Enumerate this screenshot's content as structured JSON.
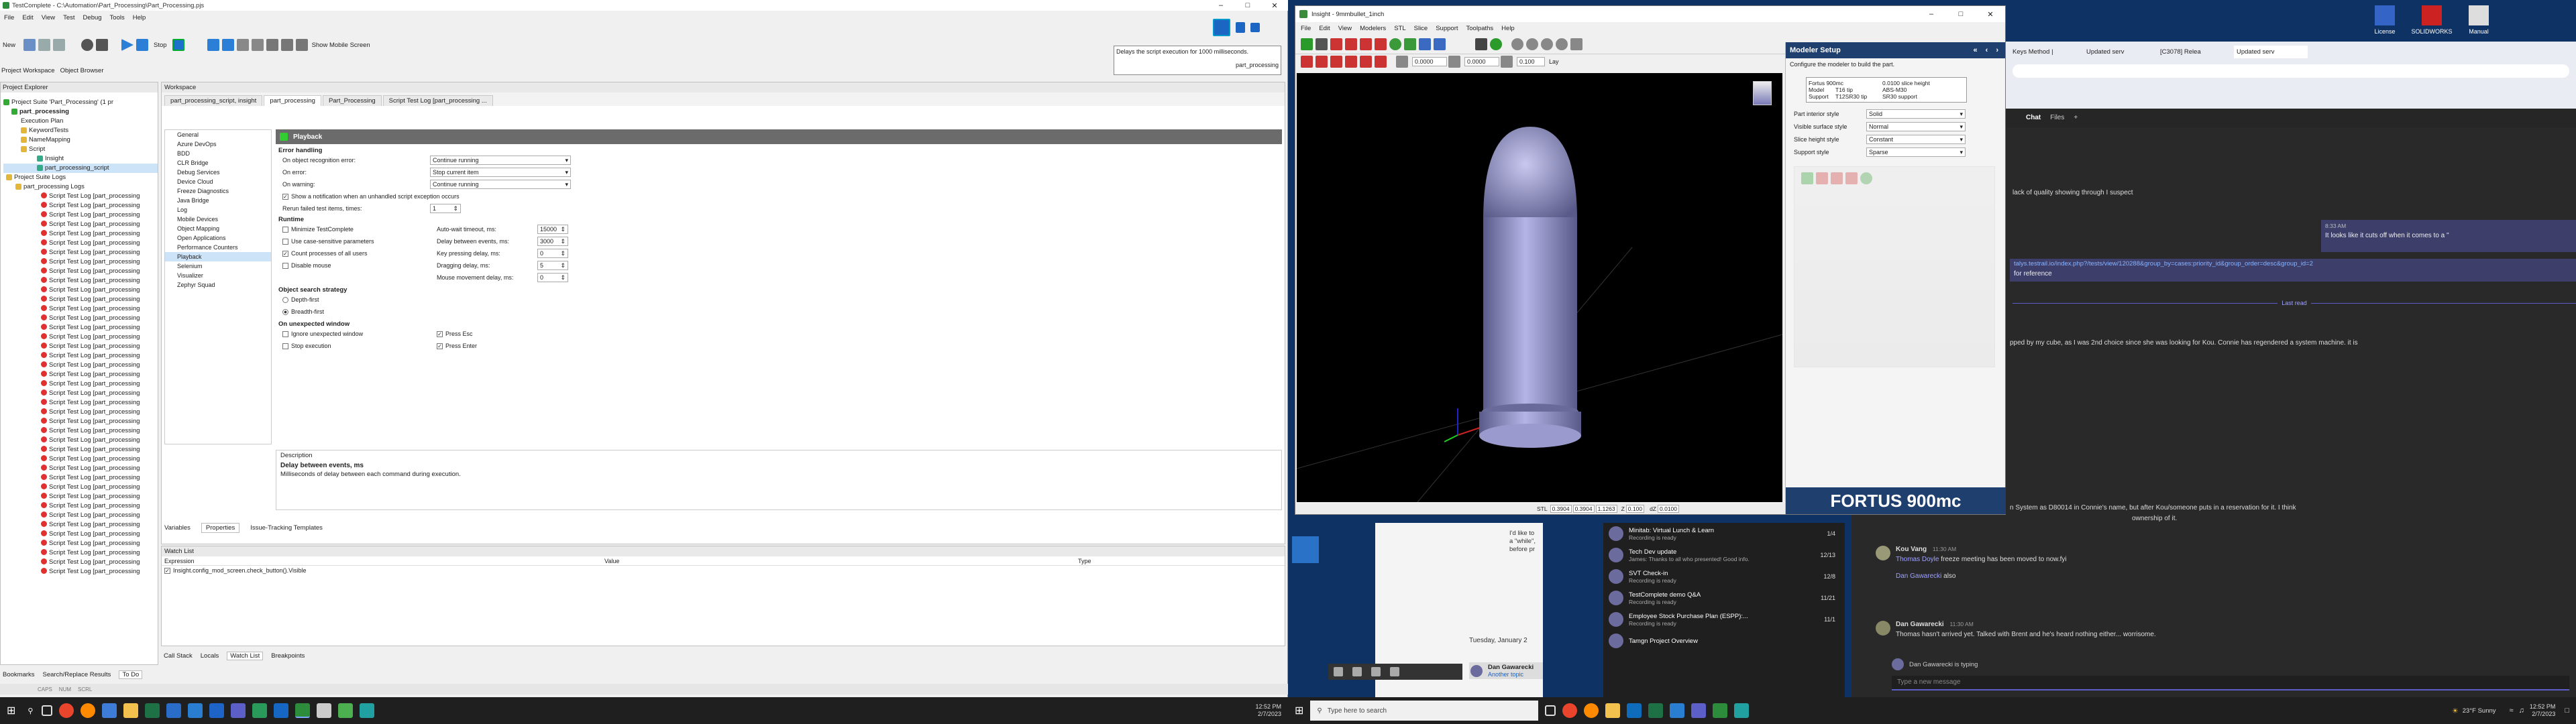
{
  "tc": {
    "title": "TestComplete - C:\\Automation\\Part_Processing\\Part_Processing.pjs",
    "menu": [
      "File",
      "Edit",
      "View",
      "Test",
      "Debug",
      "Tools",
      "Help"
    ],
    "toolbar": {
      "new": "New",
      "stop": "Stop",
      "mobile": "Show Mobile Screen"
    },
    "notice": {
      "text": "Delays the script execution for 1000 milliseconds.",
      "sub": "part_processing"
    },
    "panel_tabs": [
      "Project Workspace",
      "Object Browser"
    ],
    "explorer_title": "Project Explorer",
    "explorer_tree": [
      "Project Suite 'Part_Processing' (1 pr",
      "part_processing",
      "Execution Plan",
      "KeywordTests",
      "NameMapping",
      "Script",
      "Insight",
      "part_processing_script",
      "Project Suite Logs",
      "part_processing Logs"
    ],
    "log_label": "Script Test Log [part_processing",
    "workspace_title": "Workspace",
    "doc_tabs": [
      "part_processing_script, insight",
      "part_processing",
      "Part_Processing",
      "Script Test Log [part_processing ..."
    ],
    "settings_nav": [
      "General",
      "Azure DevOps",
      "BDD",
      "CLR Bridge",
      "Debug Services",
      "Device Cloud",
      "Freeze Diagnostics",
      "Java Bridge",
      "Log",
      "Mobile Devices",
      "Object Mapping",
      "Open Applications",
      "Performance Counters",
      "Playback",
      "Selenium",
      "Visualizer",
      "Zephyr Squad"
    ],
    "playback_header": "Playback",
    "error_handling": "Error handling",
    "err_rows": [
      {
        "label": "On object recognition error:",
        "value": "Continue running"
      },
      {
        "label": "On error:",
        "value": "Stop current item"
      },
      {
        "label": "On warning:",
        "value": "Continue running"
      }
    ],
    "show_notify": "Show a notification when an unhandled script exception occurs",
    "rerun": "Rerun failed test items, times:",
    "rerun_val": "1",
    "runtime": "Runtime",
    "runtime_checks": [
      "Minimize TestComplete",
      "Use case-sensitive parameters",
      "Count processes of all users",
      "Disable mouse"
    ],
    "runtime_fields": [
      {
        "label": "Auto-wait timeout, ms:",
        "value": "15000"
      },
      {
        "label": "Delay between events, ms:",
        "value": "3000"
      },
      {
        "label": "Key pressing delay, ms:",
        "value": "0"
      },
      {
        "label": "Dragging delay, ms:",
        "value": "5"
      },
      {
        "label": "Mouse movement delay, ms:",
        "value": "0"
      }
    ],
    "search_strategy": "Object search strategy",
    "depth_first": "Depth-first",
    "breadth_first": "Breadth-first",
    "unexpected": "On unexpected window",
    "unexp_left": [
      "Ignore unexpected window",
      "Stop execution"
    ],
    "unexp_right": [
      "Press Esc",
      "Press Enter"
    ],
    "description_title": "Description",
    "description_head": "Delay between events, ms",
    "description_text": "Milliseconds of delay between each command during execution.",
    "bottom_tabs": [
      "Variables",
      "Properties",
      "Issue-Tracking Templates"
    ],
    "watch_title": "Watch List",
    "watch_cols": [
      "Expression",
      "Value",
      "Type"
    ],
    "watch_expr": "Insight.config_mod_screen.check_button().Visible",
    "debug_tabs": [
      "Call Stack",
      "Locals",
      "Watch List",
      "Breakpoints"
    ],
    "status_tabs": [
      "Bookmarks",
      "Search/Replace Results",
      "To Do"
    ],
    "status_bar": [
      "CAPS",
      "NUM",
      "SCRL"
    ]
  },
  "insight": {
    "title": "Insight - 9mmbullet_1inch",
    "menu": [
      "File",
      "Edit",
      "View",
      "Modelers",
      "STL",
      "Slice",
      "Support",
      "Toolpaths",
      "Help"
    ],
    "modeler_title": "Modeler Setup",
    "modeler_sub": "Configure the modeler to build the part.",
    "machine_info": [
      {
        "k": "Fortus 900mc",
        "v": "0.0100 slice height"
      },
      {
        "k": "Model",
        "v": "T16 tip",
        "v2": "ABS-M30"
      },
      {
        "k": "Support",
        "v": "T12SR30 tip",
        "v2": "SR30 support"
      }
    ],
    "styles": [
      {
        "label": "Part interior style",
        "value": "Solid"
      },
      {
        "label": "Visible surface style",
        "value": "Normal"
      },
      {
        "label": "Slice height style",
        "value": "Constant"
      },
      {
        "label": "Support style",
        "value": "Sparse"
      }
    ],
    "toolbar_vals": [
      "0.0000",
      "0.0000",
      "0.100",
      "Lay"
    ],
    "status": {
      "label": "STL",
      "xyz": "0.3904",
      "y": "0.3904",
      "z": "1.1263",
      "zlabel": "Z",
      "zval": "0.100",
      "dz": "dZ",
      "dzval": "0.0100"
    },
    "brand": "FORTUS 900mc"
  },
  "teams": {
    "tabs": [
      "Chat",
      "Files"
    ],
    "msgs": [
      {
        "text": "lack of quality showing through I suspect"
      },
      {
        "time": "8:33 AM",
        "text": "It looks like it cuts off when it comes to a \""
      },
      {
        "text": "talys.testrail.io/index.php?/tests/view/120288&group_by=cases:priority_id&group_order=desc&group_id=2"
      },
      {
        "text": "for reference"
      }
    ],
    "last_read": "Last read",
    "msg_long": "pped by my cube, as I was 2nd choice since she was looking for Kou. Connie has regendered a system machine. it is",
    "msg_long2": "n System as D80014 in Connie's name, but after Kou/someone puts in a reservation for it. I think",
    "msg_long3": "ownership of it.",
    "kou_name": "Kou Vang",
    "kou_time": "11:30 AM",
    "kou_text_name": "Thomas Doyle",
    "kou_text": "freeze meeting has been moved to now.fyi",
    "kou_sub_name": "Dan Gawarecki",
    "kou_sub": "also",
    "dan_name": "Dan Gawarecki",
    "dan_time": "11:30 AM",
    "dan_text": "Thomas hasn't arrived yet.  Talked with Brent and he's heard nothing either... worrisome.",
    "typing": "Dan Gawarecki is typing",
    "compose": "Type a new message",
    "list": [
      {
        "title": "Minitab: Virtual Lunch & Learn",
        "sub": "Recording is ready",
        "date": "1/4"
      },
      {
        "title": "Tech Dev update",
        "sub": "James: Thanks to all who presented! Good info.",
        "date": "12/13"
      },
      {
        "title": "SVT Check-in",
        "sub": "Recording is ready",
        "date": "12/8"
      },
      {
        "title": "TestComplete demo Q&A",
        "sub": "Recording is ready",
        "date": "11/21"
      },
      {
        "title": "Employee Stock Purchase Plan (ESPP):...",
        "sub": "Recording is ready",
        "date": "11/1"
      },
      {
        "title": "Tamgn Project Overview",
        "sub": "",
        "date": ""
      }
    ]
  },
  "browser": {
    "tabs": [
      "Keys Method |",
      "Updated serv",
      "[C3078] Relea",
      "Updated serv"
    ]
  },
  "desktop": [
    "License",
    "SOLIDWORKS",
    "Manual"
  ],
  "outlook": {
    "date_hdr": "Tuesday, January 2",
    "from": "Dan Gawarecki",
    "sub": "Another topic",
    "peek": [
      "I'd like to",
      "a \"while\",",
      "before pr"
    ]
  },
  "taskbar": {
    "search": "Type here to search",
    "weather": "23°F  Sunny",
    "time": "12:52 PM",
    "date": "2/7/2023",
    "time2": "12:52 PM",
    "date2": "2/7/2023"
  }
}
